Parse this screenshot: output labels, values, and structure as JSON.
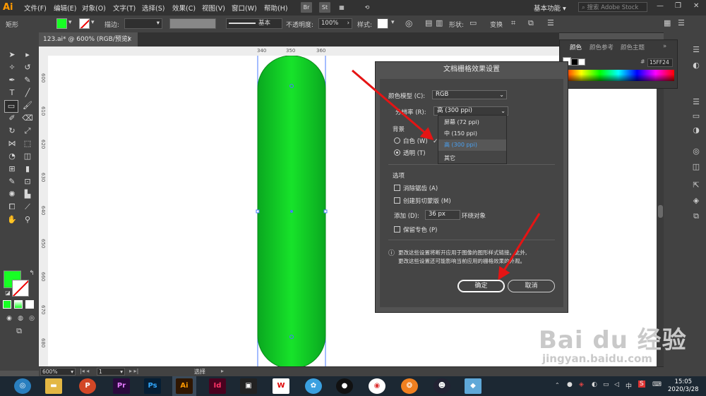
{
  "app": {
    "logo": "Ai"
  },
  "menu": [
    "文件(F)",
    "编辑(E)",
    "对象(O)",
    "文字(T)",
    "选择(S)",
    "效果(C)",
    "视图(V)",
    "窗口(W)",
    "帮助(H)"
  ],
  "menubar": {
    "br": "Br",
    "st": "St",
    "workspace": "基本功能 ▾",
    "search_placeholder": "搜索 Adobe Stock",
    "win_min": "—",
    "win_max": "❐",
    "win_close": "✕"
  },
  "control": {
    "tool_name": "矩形",
    "stroke_label": "描边:",
    "stroke_style": "基本",
    "opacity_label": "不透明度:",
    "opacity_value": "100%",
    "style_label": "样式:",
    "shape_label": "形状:",
    "transform_label": "变换",
    "fill_color": "#17ff24"
  },
  "document_tab": {
    "label": "123.ai* @ 600% (RGB/预览)",
    "close": "×"
  },
  "ruler": {
    "marks": [
      "340",
      "350",
      "360"
    ],
    "vmarks": [
      "600",
      "610",
      "620",
      "630",
      "640",
      "650",
      "660",
      "670",
      "680"
    ]
  },
  "status": {
    "zoom": "600%",
    "page": "1",
    "tool": "选择"
  },
  "color_panel": {
    "tabs": [
      "颜色",
      "颜色参考",
      "颜色主题"
    ],
    "hex": "15FF24",
    "menu": "»",
    "hash": "#"
  },
  "dialog": {
    "title": "文档栅格效果设置",
    "color_model_label": "颜色模型 (C):",
    "color_model_value": "RGB",
    "resolution_label": "分辨率 (R):",
    "resolution_value": "高 (300 ppi)",
    "background_label": "背景",
    "white_label": "白色 (W)",
    "transparent_label": "透明 (T)",
    "options_label": "选项",
    "anti_alias_label": "消除锯齿 (A)",
    "clipping_mask_label": "创建剪切蒙版 (M)",
    "add_label": "添加 (D):",
    "add_value": "36 px",
    "add_suffix": "环绕对象",
    "preserve_spot_label": "保留专色 (P)",
    "info_line1": "更改这些设置将断开应用于图像的图形样式链接。此外,",
    "info_line2": "更改这些设置还可能影响当前应用的栅格效果的外观。",
    "ok_label": "确定",
    "cancel_label": "取消"
  },
  "dropdown_options": [
    {
      "label": "屏幕 (72 ppi)",
      "selected": false
    },
    {
      "label": "中 (150 ppi)",
      "selected": false
    },
    {
      "label": "高 (300 ppi)",
      "selected": true
    },
    {
      "label": "其它",
      "selected": false
    }
  ],
  "taskbar": {
    "time": "15:05",
    "date": "2020/3/28"
  },
  "watermark": {
    "brand": "Bai du 经验",
    "url": "jingyan.baidu.com"
  }
}
